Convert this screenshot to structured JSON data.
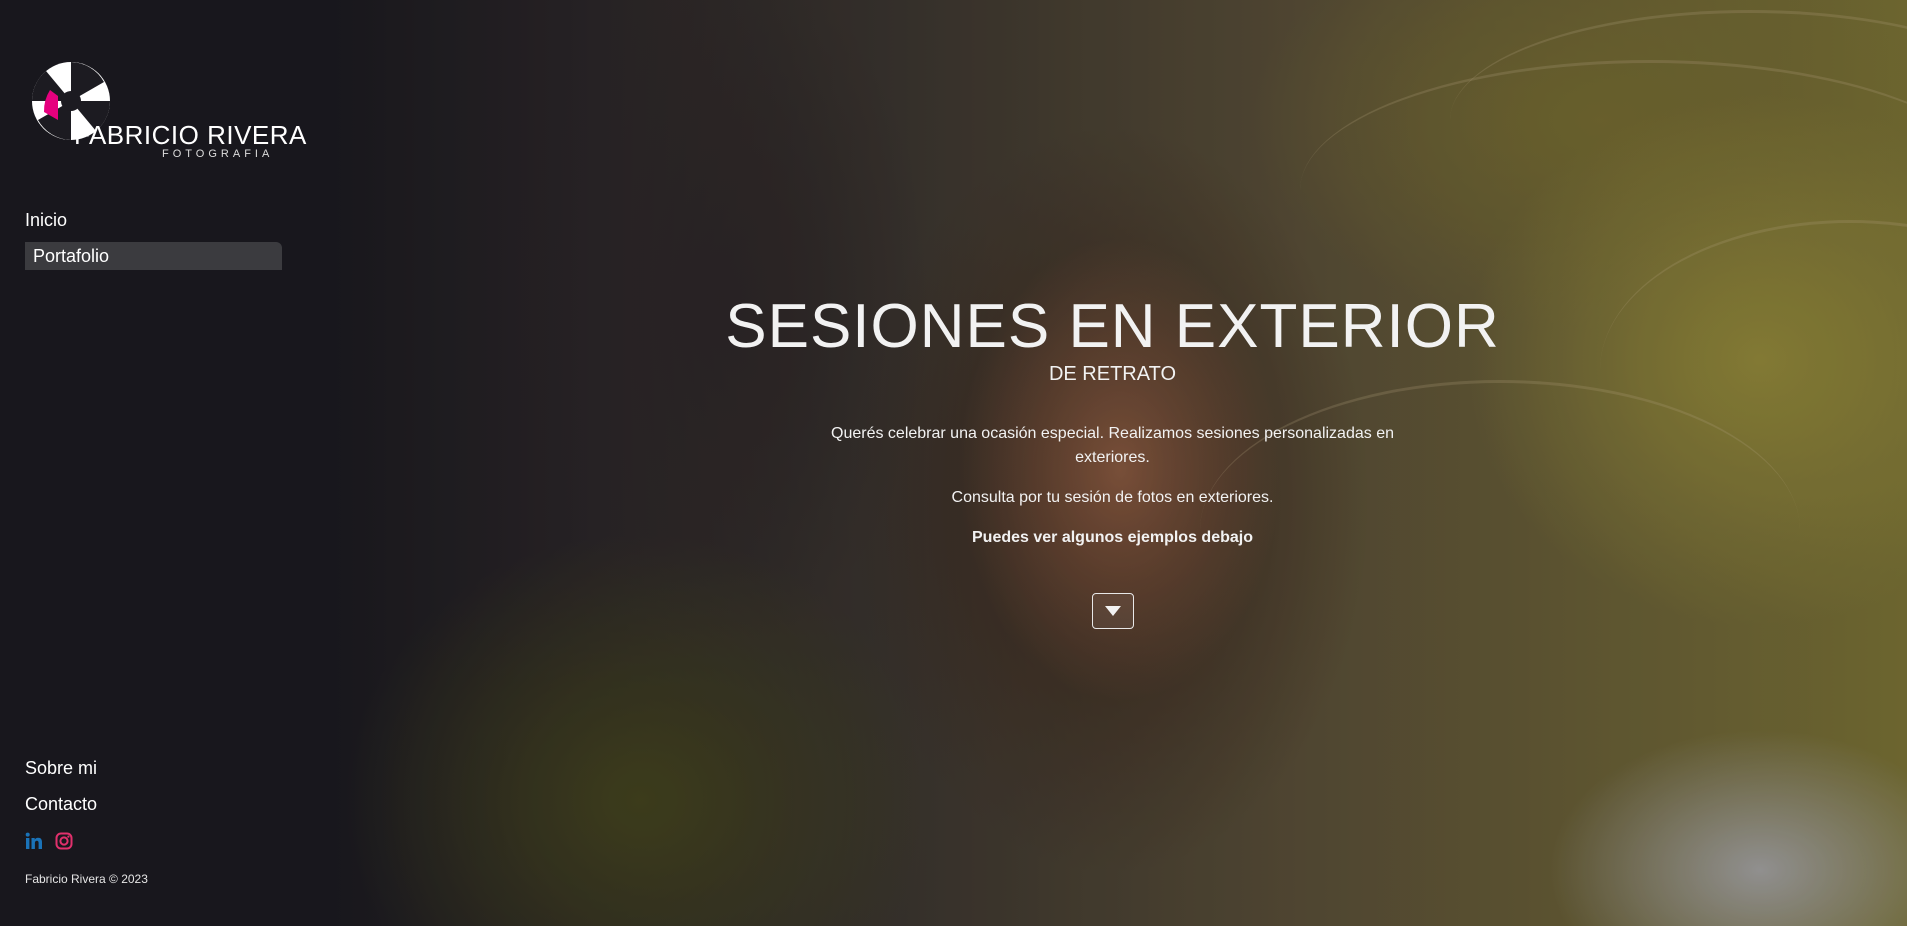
{
  "brand": {
    "name": "FABRICIO RIVERA",
    "tagline": "FOTOGRAFIA",
    "accent_color": "#e6007e"
  },
  "nav": {
    "items": [
      {
        "label": "Inicio",
        "active": false
      },
      {
        "label": "Portafolio",
        "active": true
      }
    ]
  },
  "footer_nav": {
    "about_label": "Sobre mi",
    "contact_label": "Contacto",
    "socials": [
      {
        "icon": "linkedin-icon",
        "color": "#1a73b8"
      },
      {
        "icon": "instagram-icon",
        "color": "#e1306c"
      }
    ],
    "copyright": "Fabricio Rivera © 2023"
  },
  "hero": {
    "title": "SESIONES EN EXTERIOR",
    "subtitle": "DE RETRATO",
    "paragraph_1": "Querés celebrar una ocasión especial. Realizamos sesiones personalizadas en exteriores.",
    "paragraph_2": "Consulta por tu sesión de fotos en exteriores.",
    "paragraph_3": "Puedes ver algunos ejemplos debajo",
    "scroll_icon": "chevron-down-icon"
  }
}
